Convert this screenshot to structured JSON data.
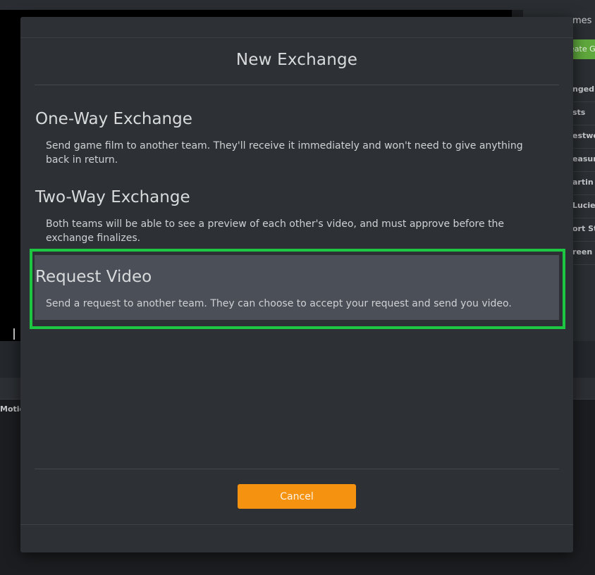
{
  "background": {
    "games_title": "mes",
    "create_button": "eate G",
    "game_list": [
      "nged",
      "sts",
      "estwo",
      "easur",
      "artin C",
      "Lucie",
      "ort St",
      "reen"
    ],
    "toolbar_label": "Motio"
  },
  "modal": {
    "title": "New Exchange",
    "options": [
      {
        "title": "One-Way Exchange",
        "description": "Send game film to another team. They'll receive it immediately and won't need to give anything back in return."
      },
      {
        "title": "Two-Way Exchange",
        "description": "Both teams will be able to see a preview of each other's video, and must approve before the exchange finalizes."
      },
      {
        "title": "Request Video",
        "description": "Send a request to another team. They can choose to accept your request and send you video.",
        "highlighted": true
      }
    ],
    "cancel_label": "Cancel"
  },
  "colors": {
    "accent_button": "#f5920f",
    "highlight_border": "#1ec742",
    "selected_option_bg": "#4a4f58",
    "modal_bg": "#2d3034"
  }
}
